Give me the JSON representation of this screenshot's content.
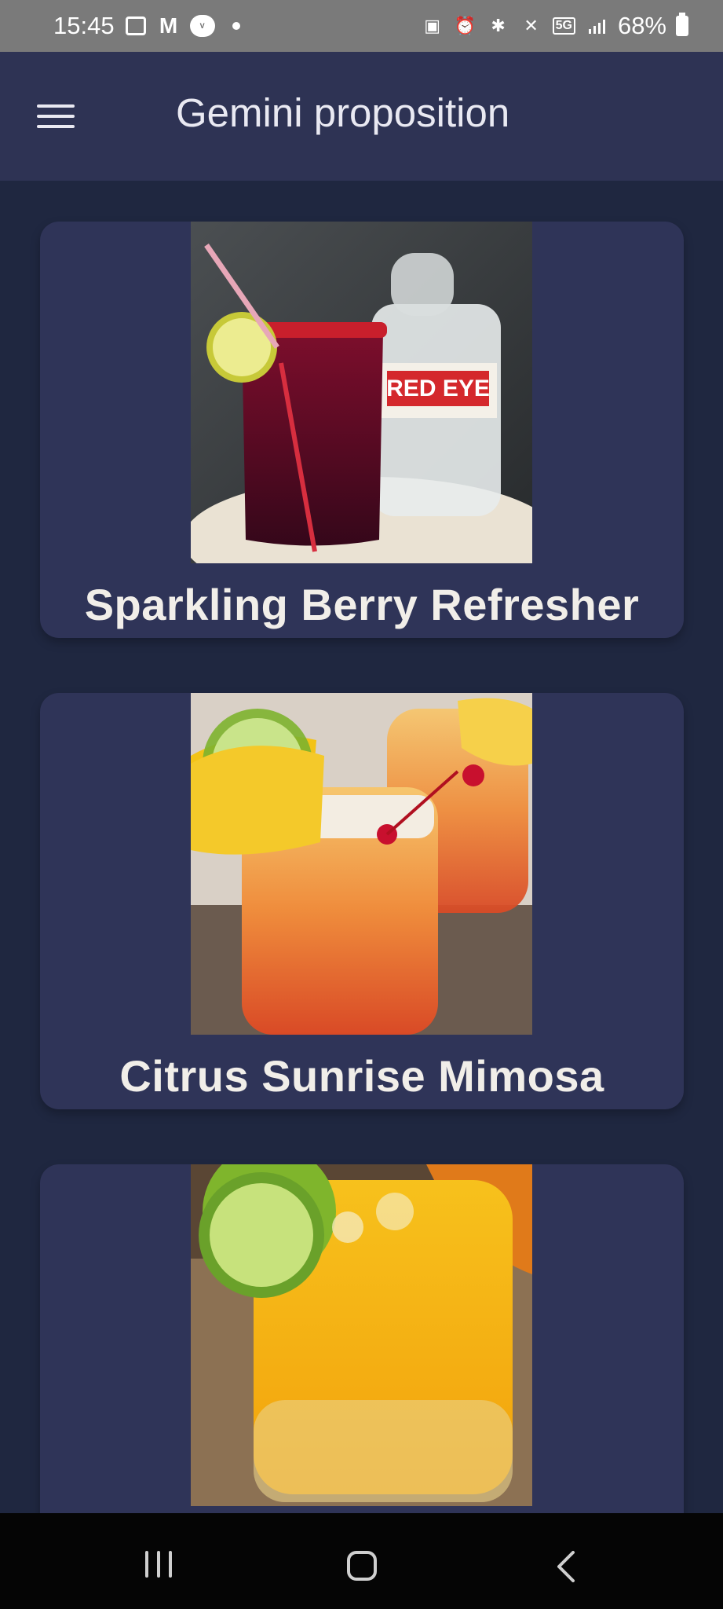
{
  "status_bar": {
    "time": "15:45",
    "battery": "68%",
    "network": "5G",
    "icons": [
      "image-icon",
      "gmail-icon",
      "vinted-icon",
      "notification-dot",
      "screenshot-icon",
      "alarm-icon",
      "bluetooth-icon",
      "mute-icon",
      "signal-icon",
      "battery-icon"
    ]
  },
  "app_bar": {
    "title": "Gemini proposition",
    "menu_icon": "hamburger-menu-icon"
  },
  "cards": [
    {
      "title": "Sparkling Berry Refresher",
      "image": "dark red berry drink with lime and straw next to a Red Eye bottle",
      "image_text": "RED EYE"
    },
    {
      "title": "Citrus Sunrise Mimosa",
      "image": "orange sunrise cocktails with pineapple, lime and cherries"
    },
    {
      "title": "",
      "image": "yellow citrus drink with ice and lime slices"
    }
  ],
  "nav_bar": {
    "icons": [
      "recents-icon",
      "home-icon",
      "back-icon"
    ]
  },
  "colors": {
    "background": "#1f2740",
    "app_bar": "#2e3354",
    "card": "#2f3458",
    "text": "#f1eee9",
    "status_bar": "#7a7a7a",
    "nav_bar": "#050505"
  }
}
